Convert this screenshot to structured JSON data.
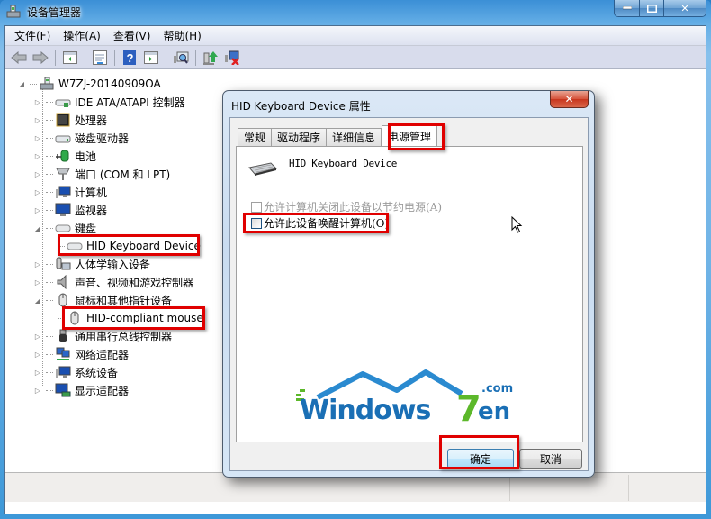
{
  "window": {
    "title": "设备管理器",
    "caption_buttons": [
      "minimize",
      "maximize",
      "close"
    ]
  },
  "menubar": {
    "items": [
      "文件(F)",
      "操作(A)",
      "查看(V)",
      "帮助(H)"
    ]
  },
  "toolbar": {
    "buttons": [
      "back-icon",
      "forward-icon",
      "show-hide-console-tree-icon",
      "properties-icon",
      "help-icon",
      "show-action-pane-icon",
      "scan-hardware-icon",
      "update-driver-icon",
      "uninstall-device-icon"
    ]
  },
  "tree": {
    "root": "W7ZJ-20140909OA",
    "items": [
      {
        "label": "IDE ATA/ATAPI 控制器",
        "icon": "ide-controller-icon",
        "expanded": false
      },
      {
        "label": "处理器",
        "icon": "processor-icon",
        "expanded": false
      },
      {
        "label": "磁盘驱动器",
        "icon": "disk-drive-icon",
        "expanded": false
      },
      {
        "label": "电池",
        "icon": "battery-icon",
        "expanded": false
      },
      {
        "label": "端口 (COM 和 LPT)",
        "icon": "port-icon",
        "expanded": false
      },
      {
        "label": "计算机",
        "icon": "computer-icon",
        "expanded": false
      },
      {
        "label": "监视器",
        "icon": "monitor-icon",
        "expanded": false
      },
      {
        "label": "键盘",
        "icon": "keyboard-icon",
        "expanded": true,
        "children": [
          "HID Keyboard Device"
        ]
      },
      {
        "label": "人体学输入设备",
        "icon": "hid-icon",
        "expanded": false
      },
      {
        "label": "声音、视频和游戏控制器",
        "icon": "sound-icon",
        "expanded": false
      },
      {
        "label": "鼠标和其他指针设备",
        "icon": "mouse-icon",
        "expanded": true,
        "children": [
          "HID-compliant mouse"
        ]
      },
      {
        "label": "通用串行总线控制器",
        "icon": "usb-icon",
        "expanded": false
      },
      {
        "label": "网络适配器",
        "icon": "network-icon",
        "expanded": false
      },
      {
        "label": "系统设备",
        "icon": "system-device-icon",
        "expanded": false
      },
      {
        "label": "显示适配器",
        "icon": "display-adapter-icon",
        "expanded": false
      }
    ]
  },
  "dialog": {
    "title": "HID Keyboard Device 属性",
    "tabs": [
      "常规",
      "驱动程序",
      "详细信息",
      "电源管理"
    ],
    "active_tab": "电源管理",
    "device_name": "HID Keyboard Device",
    "options": [
      {
        "label": "允许计算机关闭此设备以节约电源(A)",
        "checked": false,
        "enabled": false
      },
      {
        "label": "允许此设备唤醒计算机(O)",
        "checked": false,
        "enabled": true
      }
    ],
    "ok_label": "确定",
    "cancel_label": "取消"
  },
  "watermark": {
    "text": "Windows7en",
    "suffix": ".com"
  },
  "colors": {
    "highlight_box": "#e00000",
    "title_bar": "#64aee6",
    "logo_blue": "#1a6fb5",
    "logo_green": "#5cb82a"
  }
}
